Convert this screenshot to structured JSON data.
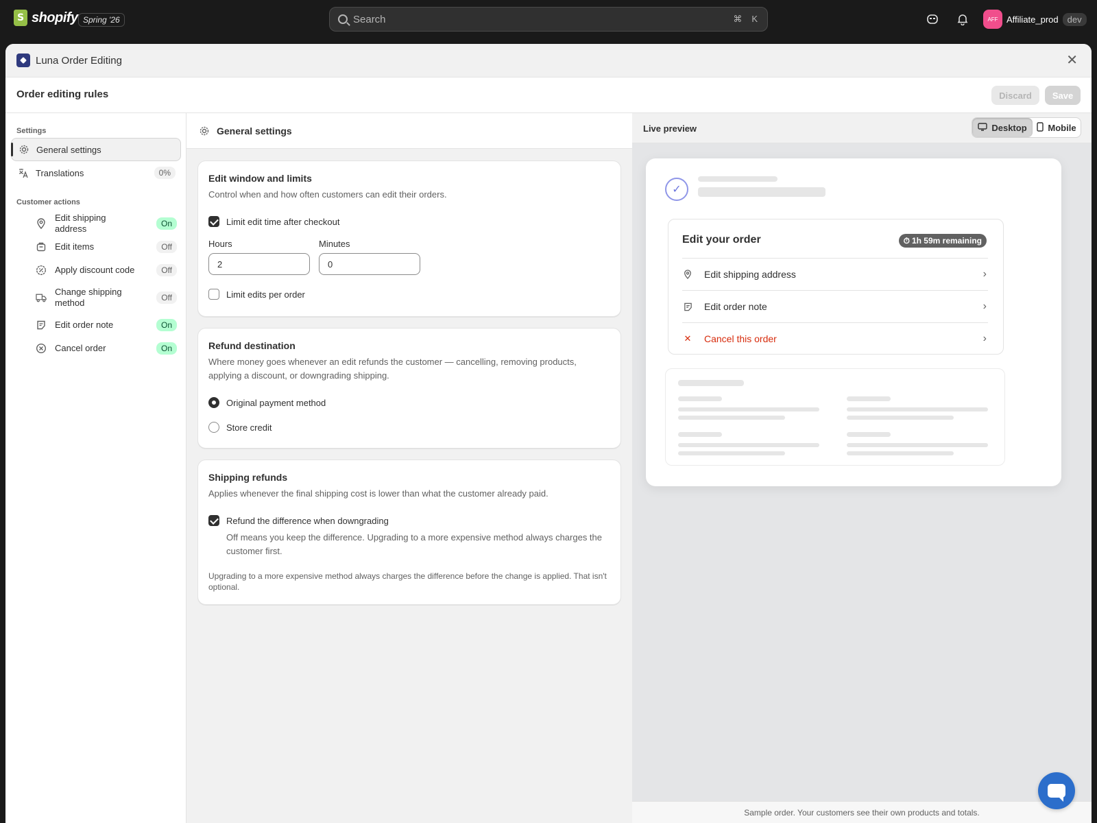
{
  "topbar": {
    "logo_text": "shopify",
    "release_badge": "Spring '26",
    "search_placeholder": "Search",
    "search_shortcut": [
      "⌘",
      "K"
    ],
    "avatar_initials": "AFF",
    "store_name": "Affiliate_prod",
    "env_badge": "dev",
    "icons": [
      "search-icon",
      "command-icon",
      "bell-icon"
    ]
  },
  "modal": {
    "app_title": "Luna Order Editing",
    "page_title": "Order editing rules",
    "discard_label": "Discard",
    "save_label": "Save"
  },
  "sidebar": {
    "settings_heading": "Settings",
    "settings_items": [
      {
        "label": "General settings",
        "icon": "gear-icon",
        "active": true
      },
      {
        "label": "Translations",
        "icon": "translate-icon",
        "badge": "0%"
      }
    ],
    "actions_heading": "Customer actions",
    "actions": [
      {
        "label": "Edit shipping address",
        "icon": "location-icon",
        "status": "On"
      },
      {
        "label": "Edit items",
        "icon": "product-icon",
        "status": "Off"
      },
      {
        "label": "Apply discount code",
        "icon": "discount-icon",
        "status": "Off"
      },
      {
        "label": "Change shipping method",
        "icon": "truck-icon",
        "status": "Off"
      },
      {
        "label": "Edit order note",
        "icon": "note-icon",
        "status": "On"
      },
      {
        "label": "Cancel order",
        "icon": "x-circle-icon",
        "status": "On"
      }
    ]
  },
  "center": {
    "title": "General settings",
    "edit_window": {
      "title": "Edit window and limits",
      "description": "Control when and how often customers can edit their orders.",
      "limit_time_label": "Limit edit time after checkout",
      "limit_time_checked": true,
      "hours_label": "Hours",
      "hours_value": "2",
      "minutes_label": "Minutes",
      "minutes_value": "0",
      "limit_edits_label": "Limit edits per order",
      "limit_edits_checked": false
    },
    "refund": {
      "title": "Refund destination",
      "description": "Where money goes whenever an edit refunds the customer — cancelling, removing products, applying a discount, or downgrading shipping.",
      "options": [
        {
          "label": "Original payment method",
          "selected": true
        },
        {
          "label": "Store credit",
          "selected": false
        }
      ]
    },
    "shipping_refunds": {
      "title": "Shipping refunds",
      "description": "Applies whenever the final shipping cost is lower than what the customer already paid.",
      "refund_diff_label": "Refund the difference when downgrading",
      "refund_diff_checked": true,
      "refund_diff_help": "Off means you keep the difference. Upgrading to a more expensive method always charges the customer first.",
      "footnote": "Upgrading to a more expensive method always charges the difference before the change is applied. That isn't optional."
    }
  },
  "preview": {
    "title": "Live preview",
    "desktop_label": "Desktop",
    "mobile_label": "Mobile",
    "edit_title": "Edit your order",
    "time_remaining": "1h 59m remaining",
    "rows": [
      {
        "label": "Edit shipping address",
        "icon": "location-icon"
      },
      {
        "label": "Edit order note",
        "icon": "note-icon"
      },
      {
        "label": "Cancel this order",
        "icon": "x-icon",
        "danger": true
      }
    ],
    "footer_note": "Sample order. Your customers see their own products and totals."
  },
  "colors": {
    "on_badge_bg": "#b4fed2",
    "danger": "#d72c0d",
    "chat_button": "#2c6ecb",
    "avatar": "#f04e8c"
  }
}
